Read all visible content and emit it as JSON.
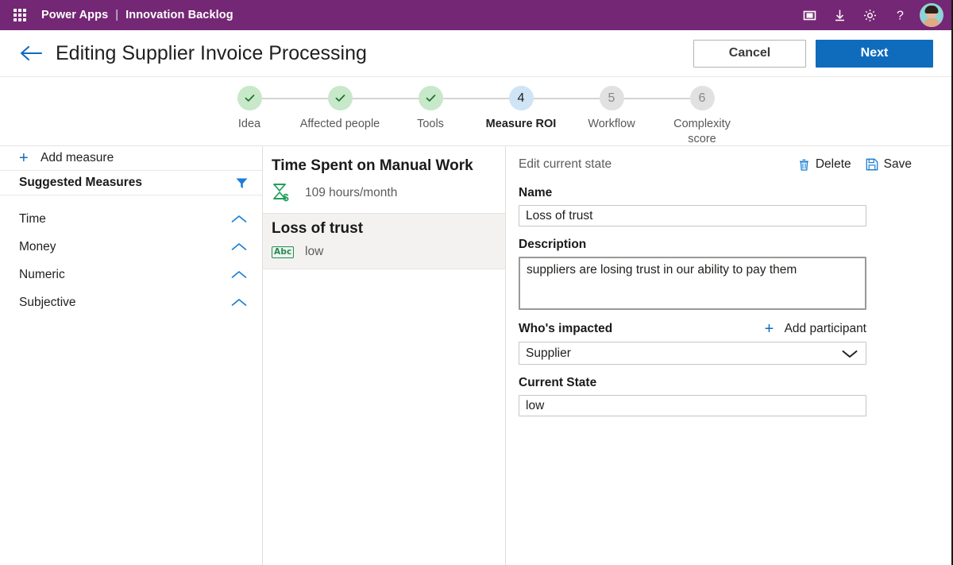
{
  "suite": {
    "waffle_icon": "app-launcher-icon",
    "product": "Power Apps",
    "separator": "|",
    "app_name": "Innovation Backlog",
    "icons": [
      {
        "name": "fit-to-screen-icon",
        "glyph": "frame"
      },
      {
        "name": "download-icon",
        "glyph": "download"
      },
      {
        "name": "settings-gear-icon",
        "glyph": "gear"
      },
      {
        "name": "help-icon",
        "glyph": "?"
      }
    ],
    "avatar_label": "user-avatar"
  },
  "header": {
    "back_icon": "back-arrow-icon",
    "title": "Editing Supplier Invoice Processing",
    "cancel_label": "Cancel",
    "next_label": "Next"
  },
  "stepper": {
    "steps": [
      {
        "number": "1",
        "label": "Idea",
        "state": "done",
        "mark": "✓"
      },
      {
        "number": "2",
        "label": "Affected people",
        "state": "done",
        "mark": "✓"
      },
      {
        "number": "3",
        "label": "Tools",
        "state": "done",
        "mark": "✓"
      },
      {
        "number": "4",
        "label": "Measure ROI",
        "state": "active",
        "mark": "4"
      },
      {
        "number": "5",
        "label": "Workflow",
        "state": "todo",
        "mark": "5"
      },
      {
        "number": "6",
        "label": "Complexity score",
        "state": "todo",
        "mark": "6"
      }
    ]
  },
  "sidebar": {
    "add_measure_label": "Add measure",
    "suggested_title": "Suggested Measures",
    "filter_icon": "filter-icon",
    "categories": [
      {
        "label": "Time",
        "chevron": "chevron-up-icon"
      },
      {
        "label": "Money",
        "chevron": "chevron-up-icon"
      },
      {
        "label": "Numeric",
        "chevron": "chevron-up-icon"
      },
      {
        "label": "Subjective",
        "chevron": "chevron-up-icon"
      }
    ]
  },
  "measures": [
    {
      "title": "Time Spent on Manual Work",
      "value": "109 hours/month",
      "icon": "hourglass-dollar-icon",
      "selected": false
    },
    {
      "title": "Loss of trust",
      "value": "low",
      "icon": "abc-text-icon",
      "icon_text": "Abc",
      "selected": true
    }
  ],
  "detail": {
    "section_label": "Edit current state",
    "delete_label": "Delete",
    "delete_icon": "trash-icon",
    "save_label": "Save",
    "save_icon": "save-floppy-icon",
    "name_label": "Name",
    "name_value": "Loss of trust",
    "description_label": "Description",
    "description_value": "suppliers are losing trust in our ability to pay them",
    "impacted_label": "Who's impacted",
    "add_participant_label": "Add participant",
    "add_participant_icon": "plus-icon",
    "participant_value": "Supplier",
    "participant_caret": "chevron-down-icon",
    "current_state_label": "Current State",
    "current_state_value": "low"
  },
  "colors": {
    "suitebar": "#742774",
    "primary_button": "#0f6cbd",
    "accent_link": "#0f6cbd",
    "step_done_bg": "#c7e8c9",
    "step_done_fg": "#1d6f2a",
    "step_active_bg": "#cfe4f5",
    "step_todo_bg": "#e1e1e1",
    "measure_icon_green": "#1a8f4e",
    "selected_card_bg": "#f3f2f1"
  }
}
